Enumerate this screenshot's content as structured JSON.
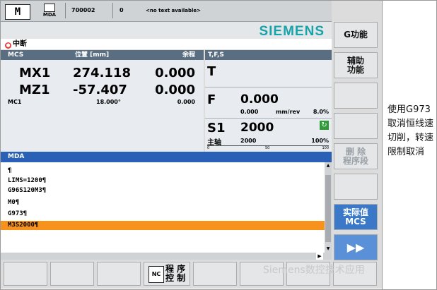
{
  "header": {
    "mode": "M",
    "mda_label": "MDA",
    "program": "700002",
    "channel": "0",
    "message": "<no text available>",
    "brand": "SIEMENS",
    "alarm": "中断"
  },
  "mcs": {
    "col_axis": "MCS",
    "col_pos": "位置 [mm]",
    "col_rem": "余程",
    "axes": [
      {
        "name": "MX1",
        "pos": "274.118",
        "rem": "0.000"
      },
      {
        "name": "MZ1",
        "pos": "-57.407",
        "rem": "0.000"
      }
    ],
    "aux": {
      "name": "MC1",
      "pos": "18.000°",
      "rem": "0.000"
    }
  },
  "tfs": {
    "title": "T,F,S",
    "t_label": "T",
    "f_label": "F",
    "f_value": "0.000",
    "f_actual": "0.000",
    "f_unit": "mm/rev",
    "f_override": "8.0%",
    "s_label": "S1",
    "s_value": "2000",
    "s_sub_label": "主轴",
    "s_actual": "2000",
    "s_override": "100%",
    "bar_ticks": [
      "0",
      "50",
      "100"
    ],
    "spindle_load": 0
  },
  "mda": {
    "title": "MDA",
    "lines": [
      "¶",
      "LIMS=1200¶",
      "G96S120M3¶",
      "M0¶",
      "G973¶",
      "M3S2000¶"
    ],
    "selected_line": 5
  },
  "softkeys_right": [
    {
      "label": "G功能",
      "state": "normal"
    },
    {
      "label": "辅助\n功能",
      "state": "normal"
    },
    {
      "label": "",
      "state": "normal"
    },
    {
      "label": "",
      "state": "normal"
    },
    {
      "label": "删 除\n程序段",
      "state": "dim"
    },
    {
      "label": "",
      "state": "normal"
    },
    {
      "label": "实际值\nMCS",
      "state": "active"
    },
    {
      "label": "▶▶",
      "state": "arrow"
    }
  ],
  "softkeys_bottom": {
    "program_control": "程 序\n控 制",
    "nc_icon": "NC"
  },
  "annotation": "使用G973取消恒线速切削，转速限制取消",
  "watermark": "Siemens数控技术应用",
  "colors": {
    "brand": "#17a3a8",
    "header": "#5a6e82",
    "mda_header": "#2a61b7",
    "highlight": "#f7931d",
    "active_key": "#3c78c8"
  }
}
